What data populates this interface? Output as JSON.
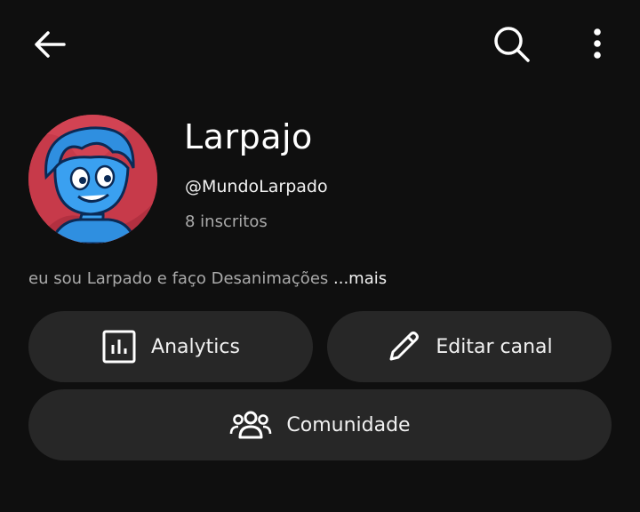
{
  "header": {
    "back_icon": "arrow-left-icon",
    "search_icon": "search-icon",
    "more_icon": "more-vertical-icon"
  },
  "channel": {
    "name": "Larpajo",
    "handle": "@MundoLarpado",
    "subscribers": "8 inscritos",
    "description": "eu sou Larpado e faço Desanimações ",
    "more_label": "...mais"
  },
  "actions": {
    "analytics_label": "Analytics",
    "edit_label": "Editar canal",
    "community_label": "Comunidade"
  },
  "colors": {
    "background": "#0f0f0f",
    "button_bg": "#272727",
    "text_primary": "#f1f1f1",
    "text_secondary": "#aaaaaa",
    "avatar_bg": "#c73a4a",
    "avatar_character": "#2f8fe0"
  }
}
